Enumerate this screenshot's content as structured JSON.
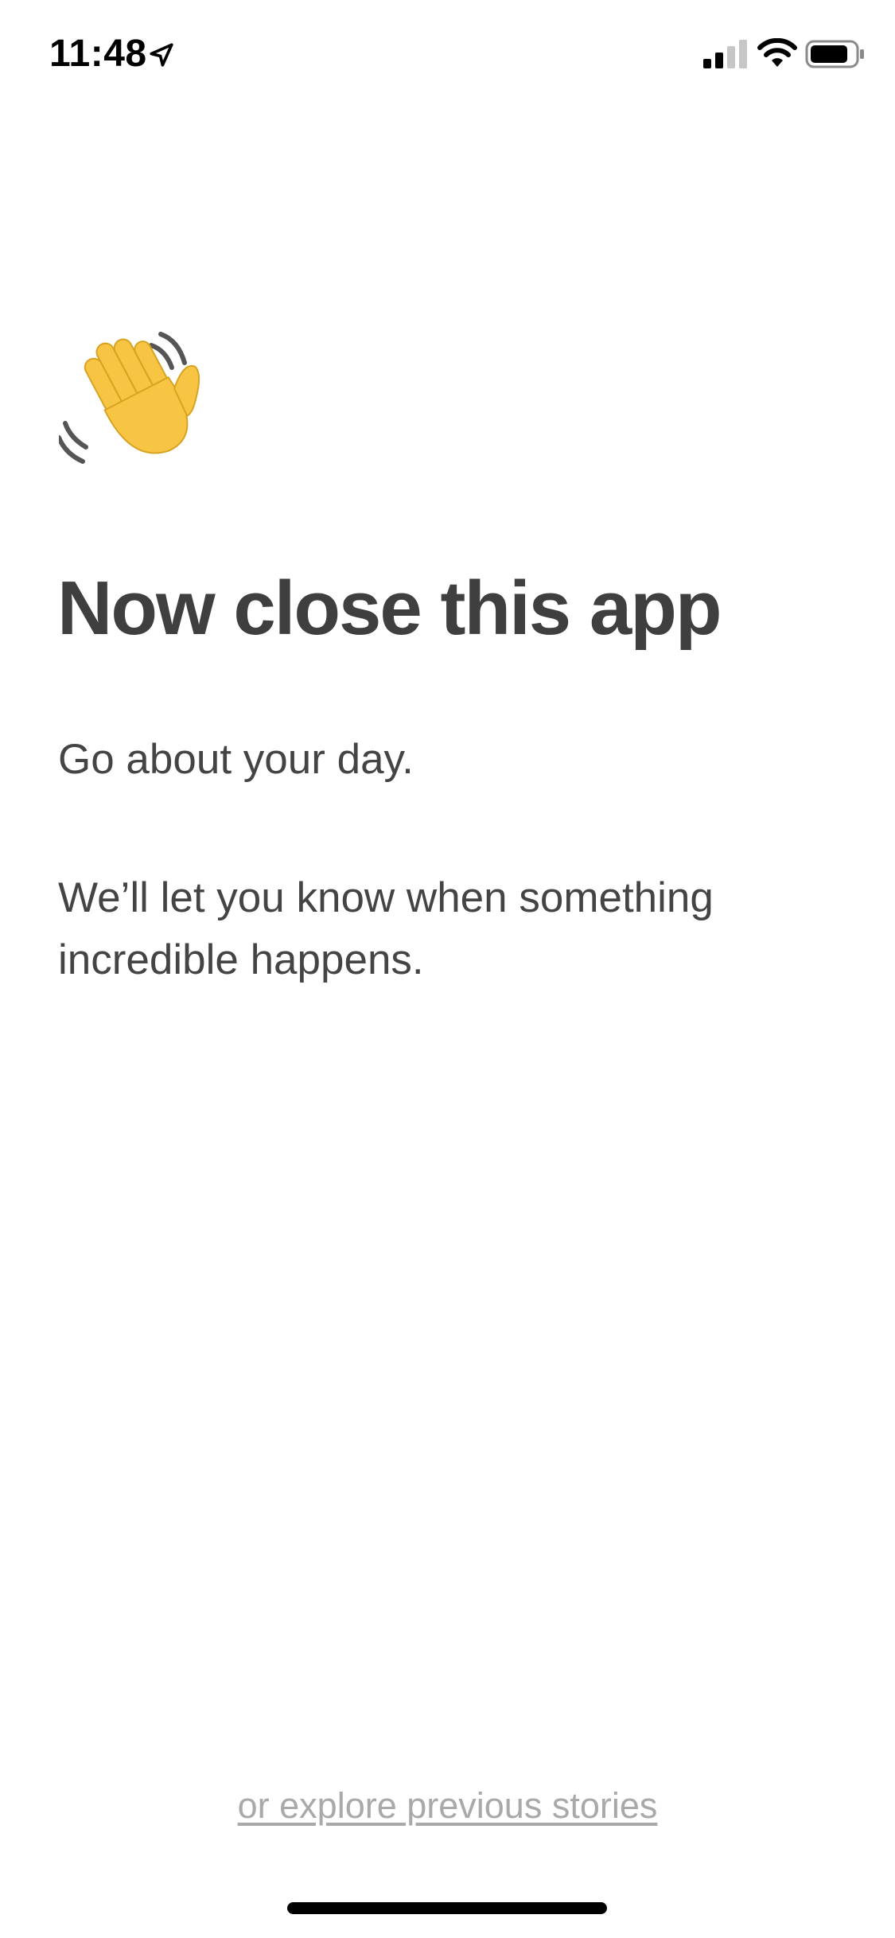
{
  "status_bar": {
    "time": "11:48",
    "icons": [
      "location-arrow-icon",
      "signal-icon",
      "wifi-icon",
      "battery-icon"
    ]
  },
  "main": {
    "emoji": "waving-hand",
    "title": "Now close this app",
    "paragraph_1": "Go about your day.",
    "paragraph_2": "We’ll let you know when something incredible happens."
  },
  "footer": {
    "explore_link": "or explore previous stories"
  },
  "colors": {
    "title_text": "#3f3f3f",
    "body_text": "#444444",
    "link_text": "#a9a9a9",
    "emoji_yellow": "#f7c443",
    "background": "#ffffff"
  }
}
